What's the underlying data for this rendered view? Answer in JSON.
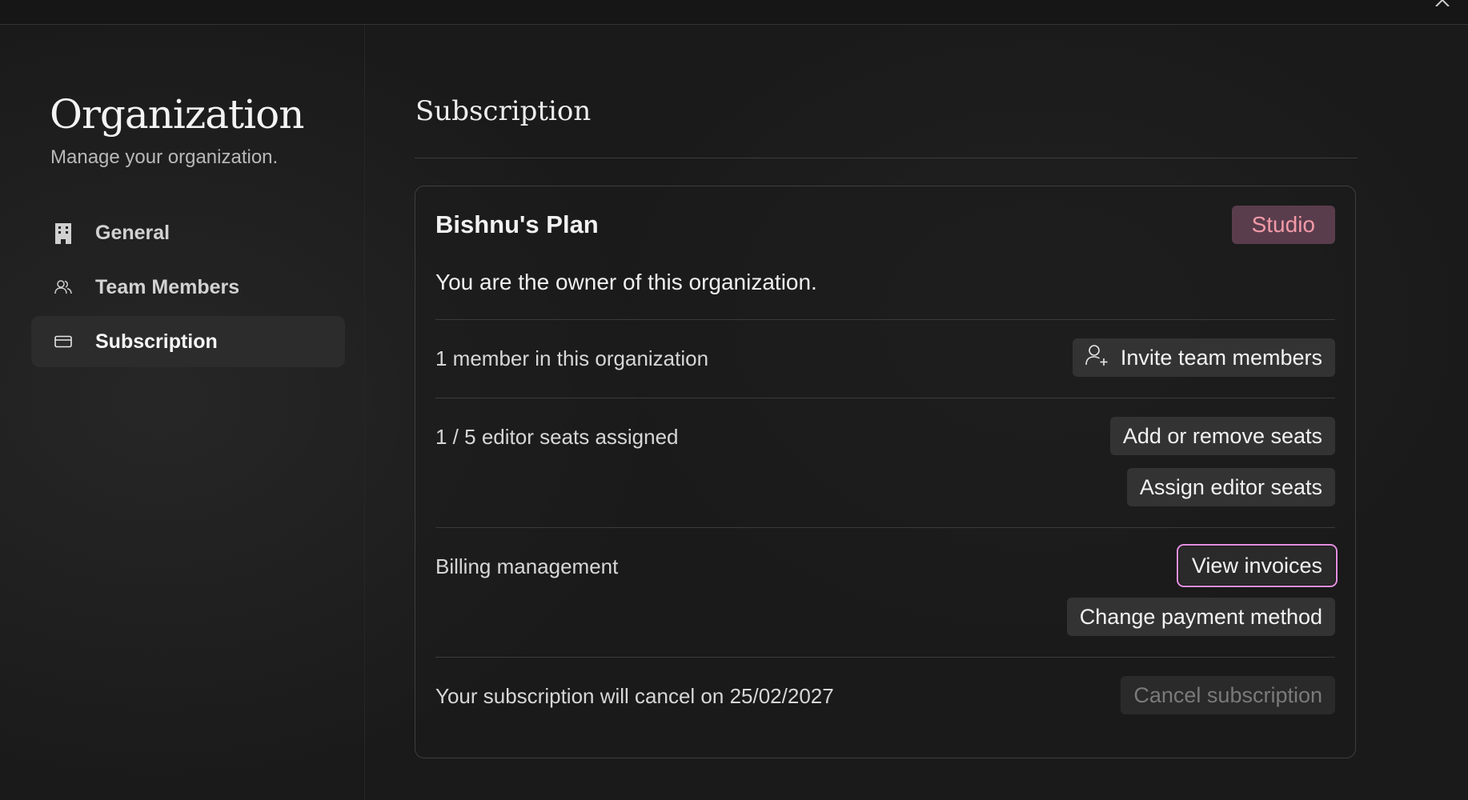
{
  "sidebar": {
    "title": "Organization",
    "subtitle": "Manage your organization.",
    "items": [
      {
        "label": "General",
        "icon": "building-icon",
        "active": false
      },
      {
        "label": "Team Members",
        "icon": "users-icon",
        "active": false
      },
      {
        "label": "Subscription",
        "icon": "credit-card-icon",
        "active": true
      }
    ]
  },
  "main": {
    "title": "Subscription",
    "card": {
      "plan_name": "Bishnu's Plan",
      "plan_badge": "Studio",
      "owner_text": "You are the owner of this organization.",
      "members_text": "1 member in this organization",
      "invite_button": "Invite team members",
      "seats_text": "1 / 5 editor seats assigned",
      "add_remove_seats_button": "Add or remove seats",
      "assign_seats_button": "Assign editor seats",
      "billing_text": "Billing management",
      "view_invoices_button": "View invoices",
      "change_payment_button": "Change payment method",
      "cancel_notice": "Your subscription will cancel on 25/02/2027",
      "cancel_button": "Cancel subscription"
    }
  },
  "colors": {
    "badge_bg": "#5a3d4d",
    "badge_text": "#f39aa8",
    "focus_ring": "#e48fe0"
  }
}
